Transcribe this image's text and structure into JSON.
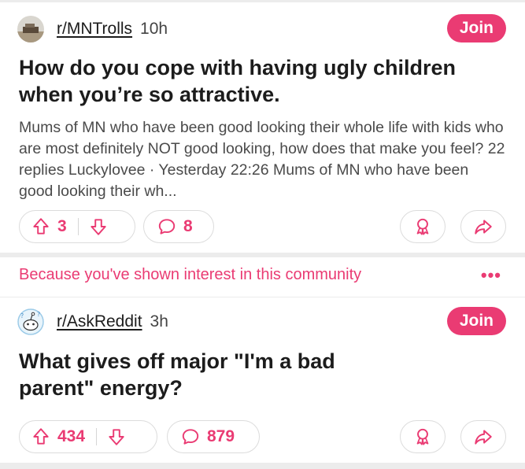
{
  "colors": {
    "accent": "#ea3b73",
    "text": "#1c1c1c",
    "muted": "#4a4a4a",
    "background": "#ececec"
  },
  "posts": [
    {
      "subreddit": "r/MNTrolls",
      "age": "10h",
      "join_label": "Join",
      "title": "How do you cope with having ugly children when you’re so attractive.",
      "body": "Mums of MN who have been good looking their whole life with kids who are most definitely NOT good looking, how does that make you feel? 22 replies Luckylovee · Yesterday 22:26 Mums of MN who have been good looking their wh...",
      "upvotes": "3",
      "comments": "8",
      "icons": [
        "upvote-icon",
        "downvote-icon",
        "comment-icon",
        "award-icon",
        "share-icon"
      ]
    },
    {
      "subreddit": "r/AskReddit",
      "age": "3h",
      "join_label": "Join",
      "title": "What gives off major \"I'm a bad parent\" energy?",
      "upvotes": "434",
      "comments": "879",
      "icons": [
        "upvote-icon",
        "downvote-icon",
        "comment-icon",
        "award-icon",
        "share-icon"
      ]
    }
  ],
  "recommendation": {
    "text": "Because you've shown interest in this community",
    "more_label": "•••"
  }
}
